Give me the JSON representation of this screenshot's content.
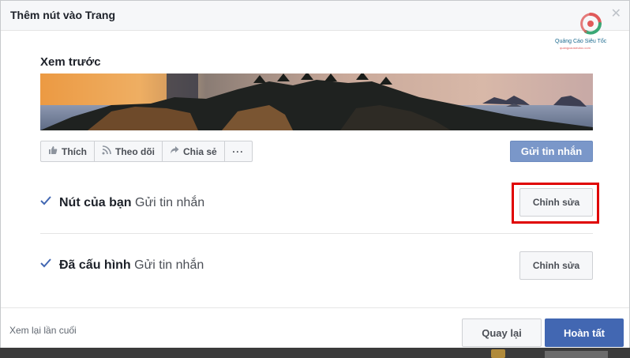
{
  "dialog": {
    "title": "Thêm nút vào Trang",
    "close_glyph": "✕"
  },
  "logo": {
    "name": "Quảng Cáo Siêu Tốc",
    "tagline": "quangcaosieutoc.com"
  },
  "preview": {
    "label": "Xem trước",
    "actions": [
      {
        "label": "Thích",
        "icon": "thumbs-up-icon"
      },
      {
        "label": "Theo dõi",
        "icon": "rss-icon"
      },
      {
        "label": "Chia sẻ",
        "icon": "share-arrow-icon"
      },
      {
        "label": "···",
        "icon": "more-icon"
      }
    ],
    "primary_button": "Gửi tin nhắn"
  },
  "rows": [
    {
      "title": "Nút của bạn",
      "value": "Gửi tin nhắn",
      "button": "Chỉnh sửa",
      "highlighted": true
    },
    {
      "title": "Đã cấu hình",
      "value": "Gửi tin nhắn",
      "button": "Chỉnh sửa",
      "highlighted": false
    }
  ],
  "footer": {
    "review_link": "Xem lại lần cuối",
    "back_button": "Quay lại",
    "done_button": "Hoàn tất"
  },
  "colors": {
    "primary": "#4267b2",
    "highlight": "#e00000"
  }
}
